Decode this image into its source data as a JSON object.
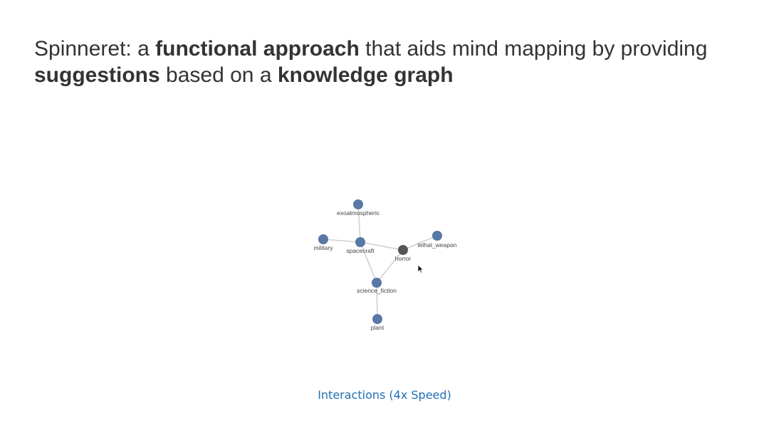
{
  "slide": {
    "title": {
      "part1": "Spinneret: a ",
      "bold1": "functional approach",
      "part2": " that aids mind mapping by providing ",
      "bold2": "suggestions",
      "part3": " based on a ",
      "bold3": "knowledge graph"
    },
    "caption": "Interactions (4x Speed)"
  },
  "graph": {
    "colors": {
      "node": "#5878a6",
      "node_active": "#555555",
      "edge": "#d0d0d0",
      "label": "#444444",
      "caption": "#1f6fb5"
    },
    "nodes": [
      {
        "id": "exoatmospheric",
        "label": "exoatmospheric",
        "active": false
      },
      {
        "id": "military",
        "label": "military",
        "active": false
      },
      {
        "id": "spacecraft",
        "label": "spacecraft",
        "active": false
      },
      {
        "id": "horror",
        "label": "horror",
        "active": true
      },
      {
        "id": "lethal_weapon",
        "label": "lethal_weapon",
        "active": false
      },
      {
        "id": "science_fiction",
        "label": "science_fiction",
        "active": false
      },
      {
        "id": "plant",
        "label": "plant",
        "active": false
      }
    ],
    "edges": [
      {
        "source": "exoatmospheric",
        "target": "spacecraft"
      },
      {
        "source": "military",
        "target": "spacecraft"
      },
      {
        "source": "spacecraft",
        "target": "horror"
      },
      {
        "source": "horror",
        "target": "lethal_weapon"
      },
      {
        "source": "spacecraft",
        "target": "science_fiction"
      },
      {
        "source": "horror",
        "target": "science_fiction"
      },
      {
        "source": "science_fiction",
        "target": "plant"
      }
    ]
  }
}
